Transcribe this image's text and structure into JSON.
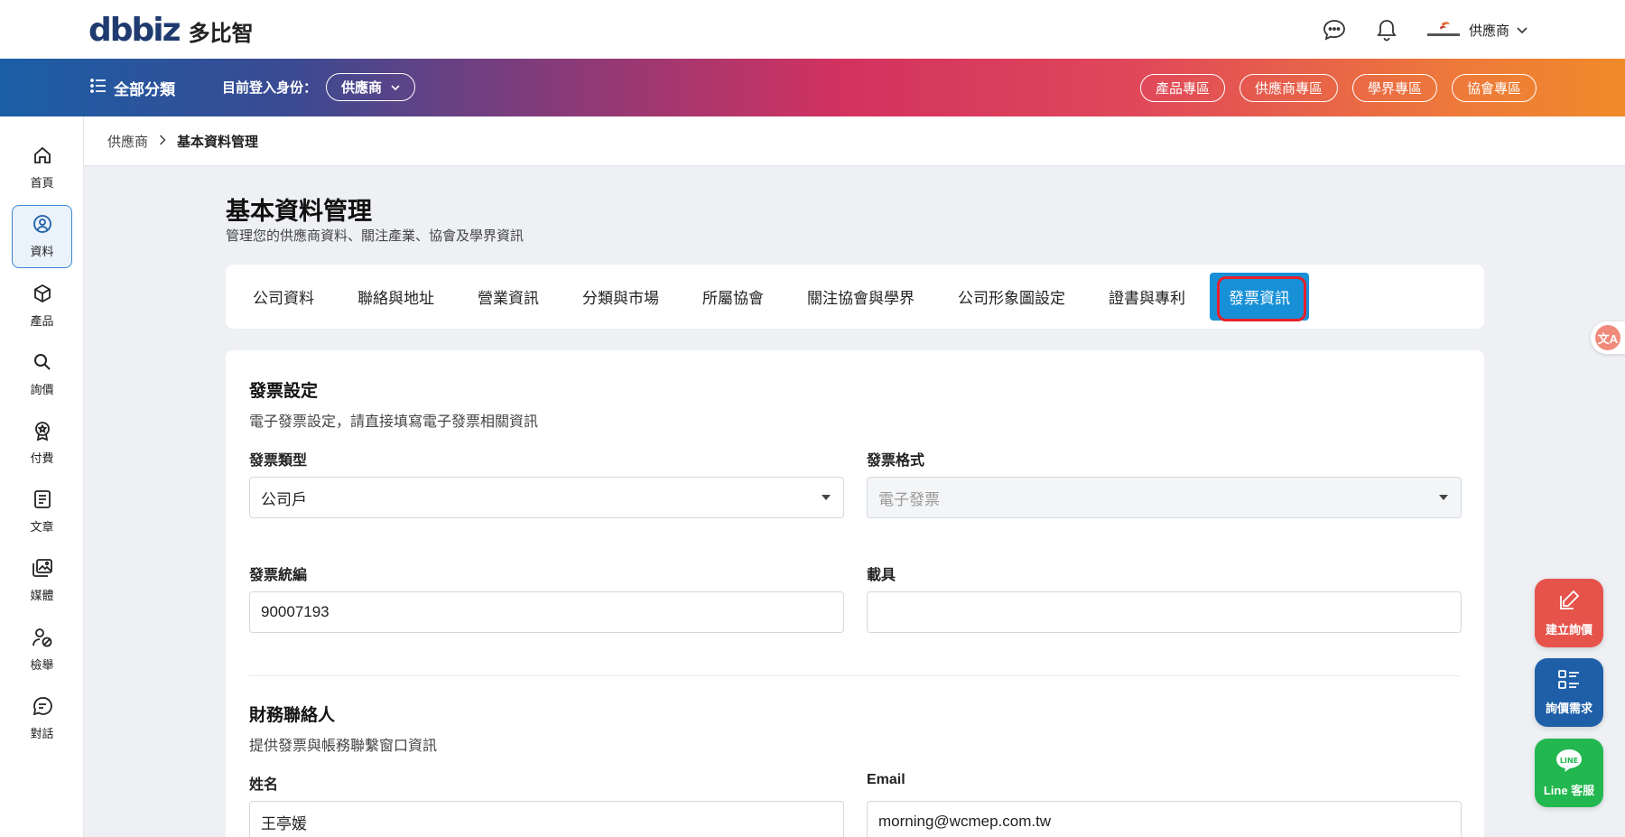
{
  "header": {
    "logo_mark": "dbbiz",
    "logo_text": "多比智",
    "user_name": "供應商"
  },
  "navbar": {
    "all_categories": "全部分類",
    "login_identity_label": "目前登入身份：",
    "role_selected": "供應商",
    "zones": [
      "產品專區",
      "供應商專區",
      "學界專區",
      "協會專區"
    ]
  },
  "sidebar": {
    "items": [
      {
        "label": "首頁",
        "icon": "home-icon"
      },
      {
        "label": "資料",
        "icon": "user-circle-icon"
      },
      {
        "label": "產品",
        "icon": "box-icon"
      },
      {
        "label": "詢價",
        "icon": "search-icon"
      },
      {
        "label": "付費",
        "icon": "badge-icon"
      },
      {
        "label": "文章",
        "icon": "document-icon"
      },
      {
        "label": "媒體",
        "icon": "media-icon"
      },
      {
        "label": "檢舉",
        "icon": "report-icon"
      },
      {
        "label": "對話",
        "icon": "chat-icon"
      }
    ]
  },
  "breadcrumb": {
    "parent": "供應商",
    "current": "基本資料管理"
  },
  "page": {
    "title": "基本資料管理",
    "subtitle": "管理您的供應商資料、關注產業、協會及學界資訊"
  },
  "tabs": [
    "公司資料",
    "聯絡與地址",
    "營業資訊",
    "分類與市場",
    "所屬協會",
    "關注協會與學界",
    "公司形象圖設定",
    "證書與專利",
    "發票資訊"
  ],
  "invoice": {
    "section_title": "發票設定",
    "section_desc": "電子發票設定，請直接填寫電子發票相關資訊",
    "type_label": "發票類型",
    "type_value": "公司戶",
    "format_label": "發票格式",
    "format_value": "電子發票",
    "tax_id_label": "發票統編",
    "tax_id_value": "90007193",
    "carrier_label": "載具",
    "carrier_value": ""
  },
  "finance": {
    "section_title": "財務聯絡人",
    "section_desc": "提供發票與帳務聯繫窗口資訊",
    "name_label": "姓名",
    "name_value": "王亭媛",
    "email_label": "Email",
    "email_value": "morning@wcmep.com.tw"
  },
  "floating": {
    "create_inquiry": "建立詢價",
    "inquiry_needs": "詢價需求",
    "line_service": "Line 客服",
    "line_badge": "LINE",
    "translate_glyph": "文A"
  }
}
